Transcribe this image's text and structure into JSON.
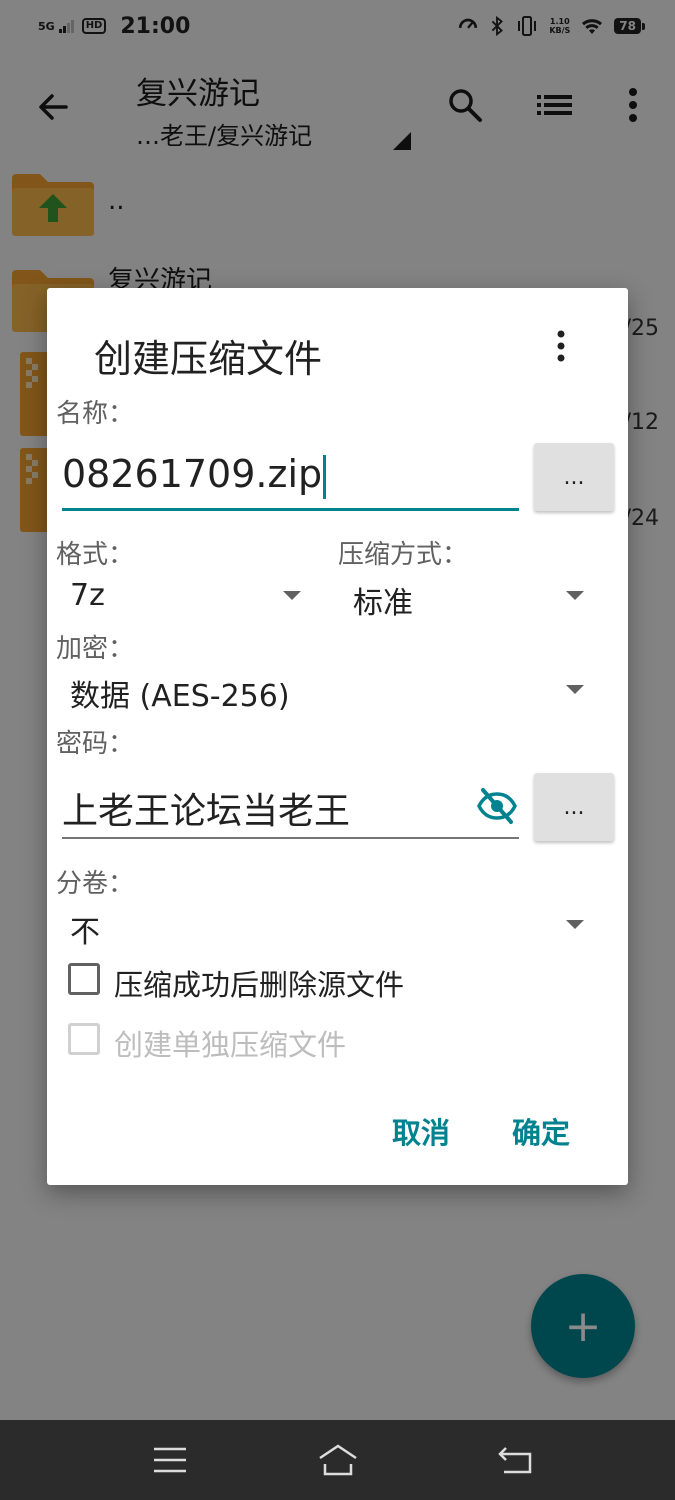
{
  "status_bar": {
    "network": "5G",
    "hd": "HD",
    "time": "21:00",
    "speed_value": "1.10",
    "speed_unit": "KB/S",
    "battery": "78"
  },
  "app_bar": {
    "title": "复兴游记",
    "path": "…老王/复兴游记"
  },
  "file_list": [
    {
      "name": "..",
      "date": ""
    },
    {
      "name": "复兴游记",
      "date": "/25"
    },
    {
      "name": "",
      "date": "/12"
    },
    {
      "name": "",
      "date": "/24"
    }
  ],
  "dialog": {
    "title": "创建压缩文件",
    "name_label": "名称：",
    "name_value": "08261709.zip",
    "browse_label": "...",
    "format_label": "格式：",
    "format_value": "7z",
    "method_label": "压缩方式：",
    "method_value": "标准",
    "encrypt_label": "加密：",
    "encrypt_value": "数据 (AES-256)",
    "password_label": "密码：",
    "password_value": "上老王论坛当老王",
    "split_label": "分卷：",
    "split_value": "不",
    "delete_source_label": "压缩成功后删除源文件",
    "separate_archive_label": "创建单独压缩文件",
    "cancel_label": "取消",
    "ok_label": "确定"
  },
  "fab": {
    "label": "+"
  },
  "colors": {
    "accent": "#00838f",
    "folder": "#f0a030",
    "folder_arrow": "#3d9a35"
  }
}
